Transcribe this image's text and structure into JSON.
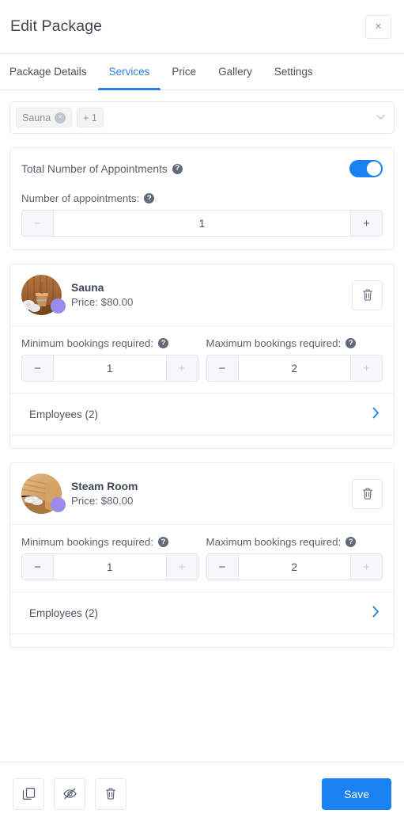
{
  "header": {
    "title": "Edit Package",
    "close_label": "×"
  },
  "tabs": [
    {
      "label": "Package Details",
      "active": false
    },
    {
      "label": "Services",
      "active": true
    },
    {
      "label": "Price",
      "active": false
    },
    {
      "label": "Gallery",
      "active": false
    },
    {
      "label": "Settings",
      "active": false
    }
  ],
  "services_select": {
    "chips": [
      {
        "label": "Sauna",
        "remove_label": "×"
      },
      {
        "label": "+ 1"
      }
    ],
    "caret": "⌄"
  },
  "appointments": {
    "section_label": "Total Number of Appointments",
    "section_help": "?",
    "toggle_on": true,
    "field_label": "Number of appointments:",
    "field_help": "?",
    "value": "1",
    "minus": "−",
    "plus": "+",
    "minus_disabled": true,
    "plus_disabled": false
  },
  "services": [
    {
      "name": "Sauna",
      "price": "Price: $80.00",
      "badge_color": "#9b8bed",
      "delete_icon": "trash-icon",
      "min": {
        "label": "Minimum bookings required:",
        "help": "?",
        "value": "1",
        "minus": "−",
        "plus": "+",
        "minus_disabled": false,
        "plus_disabled": true
      },
      "max": {
        "label": "Maximum bookings required:",
        "help": "?",
        "value": "2",
        "minus": "−",
        "plus": "+",
        "minus_disabled": false,
        "plus_disabled": true
      },
      "employees_label": "Employees (2)",
      "employees_chevron": "›"
    },
    {
      "name": "Steam Room",
      "price": "Price: $80.00",
      "badge_color": "#9b8bed",
      "delete_icon": "trash-icon",
      "min": {
        "label": "Minimum bookings required:",
        "help": "?",
        "value": "1",
        "minus": "−",
        "plus": "+",
        "minus_disabled": false,
        "plus_disabled": true
      },
      "max": {
        "label": "Maximum bookings required:",
        "help": "?",
        "value": "2",
        "minus": "−",
        "plus": "+",
        "minus_disabled": false,
        "plus_disabled": true
      },
      "employees_label": "Employees (2)",
      "employees_chevron": "›"
    }
  ],
  "footer": {
    "duplicate_icon": "duplicate-icon",
    "hide_icon": "eye-off-icon",
    "delete_icon": "trash-icon",
    "save_label": "Save"
  },
  "colors": {
    "accent": "#1a82f0",
    "tab_active": "#2a82e8",
    "badge_purple": "#9b8bed",
    "text_primary": "#3f4654",
    "text_secondary": "#5a6270",
    "border": "#e9ebf0"
  }
}
